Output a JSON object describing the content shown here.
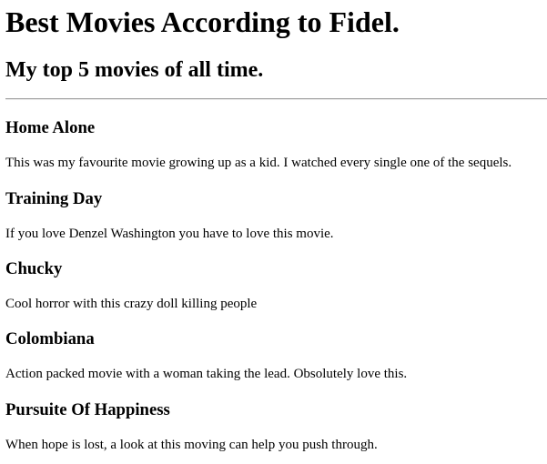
{
  "page": {
    "title": "Best Movies According to Fidel.",
    "subtitle": "My top 5 movies of all time."
  },
  "movies": [
    {
      "title": "Home Alone",
      "description": "This was my favourite movie growing up as a kid. I watched every single one of the sequels."
    },
    {
      "title": "Training Day",
      "description": "If you love Denzel Washington you have to love this movie."
    },
    {
      "title": "Chucky",
      "description": "Cool horror with this crazy doll killing people"
    },
    {
      "title": "Colombiana",
      "description": "Action packed movie with a woman taking the lead. Obsolutely love this."
    },
    {
      "title": "Pursuite Of Happiness",
      "description": "When hope is lost, a look at this moving can help you push through."
    }
  ]
}
